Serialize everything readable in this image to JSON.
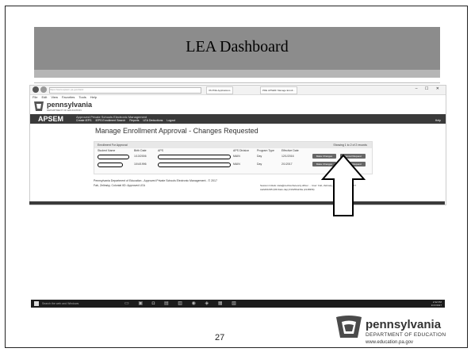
{
  "slide": {
    "title": "LEA Dashboard",
    "page_number": "27"
  },
  "browser": {
    "url": "https://www.apsem.pa.gov/LEA/",
    "tabs": [
      "IIS PDE Applications",
      "PDE APSEM: Manage Enroll..."
    ],
    "window_controls": "– ☐ ✕",
    "menu": [
      "File",
      "Edit",
      "View",
      "Favorites",
      "Tools",
      "Help"
    ]
  },
  "site": {
    "brand": "pennsylvania",
    "brand_sub": "DEPARTMENT OF EDUCATION",
    "app": "APSEM",
    "app_title": "Approved Private Schools Electronic Management",
    "nav": [
      "Create IEPS",
      "IEPS Enrollment Search",
      "Reports",
      "LEA Deductions",
      "Logout"
    ],
    "help": "Help"
  },
  "page": {
    "title": "Manage Enrollment Approval - Changes Requested",
    "panel_title": "Enrollment For Approval",
    "showing": "Showing 1 to 2 of 2 records",
    "columns": [
      "Student Name",
      "Birth Date",
      "APS",
      "APS Division",
      "Program Type",
      "Effective Date"
    ],
    "rows": [
      {
        "birth_date": "1/13/2006",
        "division": "MAIN",
        "program": "Day",
        "effective": "12/1/2016",
        "btn1": "Make Changes",
        "btn2": "Cancel Request"
      },
      {
        "birth_date": "10/4/1996",
        "division": "MAIN",
        "program": "Day",
        "effective": "2/1/2017",
        "btn1": "Make Changes",
        "btn2": "Cancel Request"
      }
    ],
    "footer_left": "Pennsylvania Department of Education - Approved Private Schools Electronic Management - © 2017",
    "footer_user": "Fab, Zelinsky, Colonial IID: Approved LEA",
    "footer_right_1": "Session Initials: data@cecbsurfaceonly.officer ... User: Fab, Zelinsky, LEA: Colonial ID: 477",
    "footer_right_2": "LEA#21095 (RR #aim-ilap) #16256dcf3a (2148356)"
  },
  "taskbar": {
    "search": "Search the web and Windows",
    "time": "2:32 PM",
    "date": "1/17/2017"
  },
  "footer_logo": {
    "word": "pennsylvania",
    "sub": "DEPARTMENT OF EDUCATION",
    "url": "www.education.pa.gov"
  },
  "colors": {
    "header": "#8c8c8c",
    "app_bar": "#3a3a3a",
    "button": "#666666"
  }
}
